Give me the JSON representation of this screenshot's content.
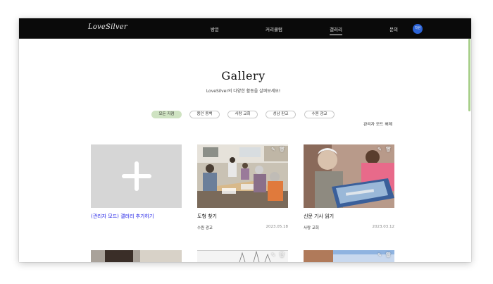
{
  "header": {
    "logo": "LoveSilver",
    "nav": [
      {
        "label": "방문"
      },
      {
        "label": "커리큘럼"
      },
      {
        "label": "갤러리",
        "active": true
      },
      {
        "label": "문의"
      }
    ],
    "user_avatar": "자원"
  },
  "page": {
    "title": "Gallery",
    "subtitle": "LoveSilver의 다양한 활동을 살펴보세요!"
  },
  "filters": [
    {
      "label": "모든 지점",
      "active": true
    },
    {
      "label": "용인 동백"
    },
    {
      "label": "사랑 교회"
    },
    {
      "label": "성남 판교"
    },
    {
      "label": "수원 광교"
    }
  ],
  "admin_toggle": "관리자 모드 해제",
  "cards": [
    {
      "title": "(관리자 모드) 갤러리 추가하기",
      "location": "",
      "date": "",
      "image": "add-placeholder"
    },
    {
      "title": "도형 찾기",
      "location": "수원 광교",
      "date": "2023.05.18",
      "image": "classroom-photo"
    },
    {
      "title": "신문 기사 읽기",
      "location": "사랑 교회",
      "date": "2023.03.12",
      "image": "newspaper-photo"
    }
  ],
  "colors": {
    "header_bg": "#0a0a0a",
    "active_filter": "#cfe3c2",
    "admin_link": "#1a1ae6",
    "avatar": "#2c63d6",
    "scrollbar": "#a8cf8a"
  },
  "icons": [
    "plus-icon",
    "edit-icon",
    "delete-icon"
  ]
}
